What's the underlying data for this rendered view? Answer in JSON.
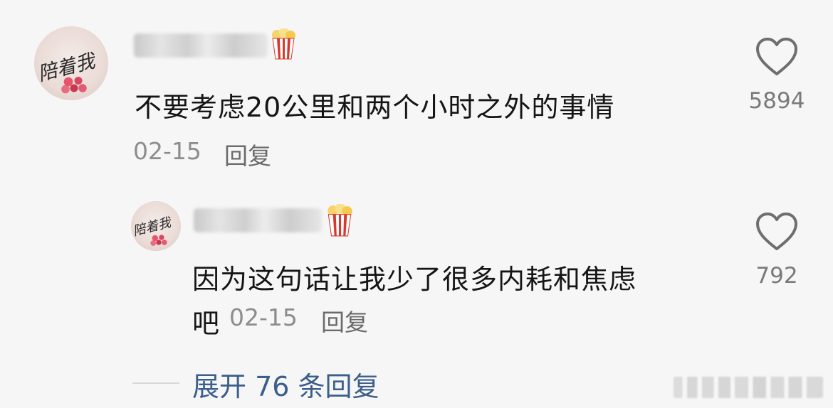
{
  "comment": {
    "avatar_text": "陪着我",
    "username": "",
    "username_emoji": "popcorn",
    "text": "不要考虑20公里和两个小时之外的事情",
    "date": "02-15",
    "reply_label": "回复",
    "like_count": "5894",
    "like_icon": "heart-outline-icon"
  },
  "reply": {
    "avatar_text": "陪着我",
    "username": "",
    "username_emoji": "popcorn",
    "text_line1": "因为这句话让我少了很多内耗和焦虑",
    "text_line2": "吧",
    "date": "02-15",
    "reply_label": "回复",
    "like_count": "792",
    "like_icon": "heart-outline-icon"
  },
  "expand_replies": {
    "label": "展开 76 条回复"
  },
  "colors": {
    "background": "#f6f6f6",
    "text": "#151515",
    "meta": "#8d8d8d",
    "expand_link": "#3b5e8c"
  }
}
